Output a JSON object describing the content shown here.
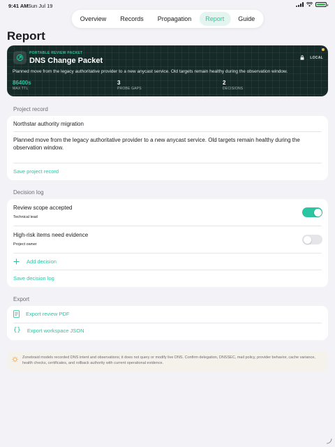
{
  "status": {
    "time": "9:41 AM",
    "date": "Sun Jul 19"
  },
  "tabs": [
    {
      "label": "Overview"
    },
    {
      "label": "Records"
    },
    {
      "label": "Propagation"
    },
    {
      "label": "Report"
    },
    {
      "label": "Guide"
    }
  ],
  "active_tab": "Report",
  "page": {
    "title": "Report"
  },
  "hero": {
    "kicker": "PORTABLE REVIEW PACKET",
    "title": "DNS Change Packet",
    "badge": "LOCAL",
    "description": "Planned move from the legacy authoritative provider to a new anycast service. Old targets remain healthy during the observation window.",
    "metrics": [
      {
        "value": "86400s",
        "label": "MAX TTL"
      },
      {
        "value": "3",
        "label": "PROBE GAPS"
      },
      {
        "value": "2",
        "label": "DECISIONS"
      }
    ]
  },
  "project_record": {
    "section_label": "Project record",
    "name": "Northstar authority migration",
    "notes": "Planned move from the legacy authoritative provider to a new anycast service. Old targets remain healthy during the observation window.",
    "save_label": "Save project record"
  },
  "decision_log": {
    "section_label": "Decision log",
    "items": [
      {
        "title": "Review scope accepted",
        "owner": "Technical lead",
        "enabled": true
      },
      {
        "title": "High-risk items need evidence",
        "owner": "Project owner",
        "enabled": false
      }
    ],
    "add_label": "Add decision",
    "save_label": "Save decision log"
  },
  "export": {
    "section_label": "Export",
    "pdf_label": "Export review PDF",
    "json_label": "Export workspace JSON"
  },
  "note": {
    "text": "Zonebraid models recorded DNS intent and observations; it does not query or modify live DNS. Confirm delegation, DNSSEC, mail policy, provider behavior, cache variance, health checks, certificates, and rollback authority with current operational evidence."
  },
  "colors": {
    "accent": "#2cc5a2",
    "background": "#f2f2f7",
    "hero_bg": "#162a27",
    "note_icon": "#f0a85a"
  }
}
